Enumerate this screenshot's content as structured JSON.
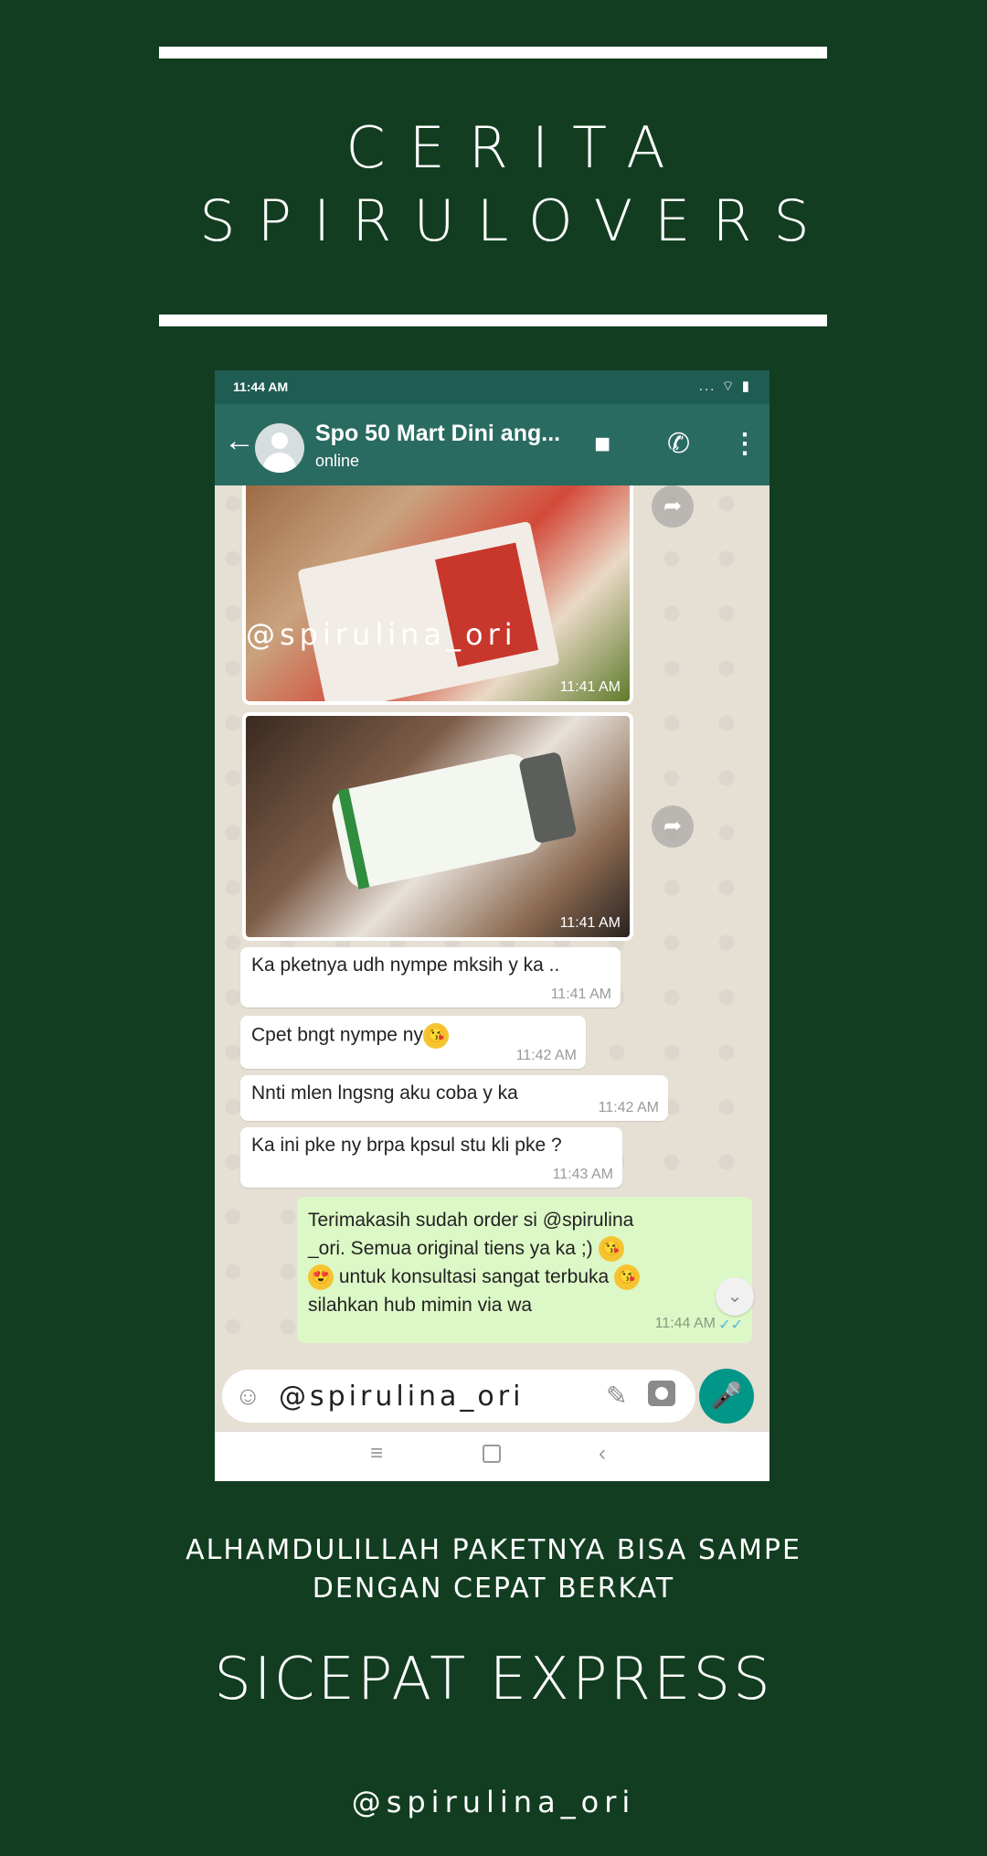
{
  "poster": {
    "title_line1": "CERITA",
    "title_line2": "SPIRULOVERS",
    "caption_line1": "ALHAMDULILLAH PAKETNYA BISA SAMPE",
    "caption_line2": "DENGAN CEPAT BERKAT",
    "headline": "SICEPAT EXPRESS",
    "handle": "@spirulina_ori",
    "colors": {
      "background": "#123d21",
      "text": "#ffffff"
    }
  },
  "status_bar": {
    "time": "11:44 AM",
    "icons": "... ⌔ ▮"
  },
  "chat_header": {
    "back_icon": "←",
    "contact_name": "Spo 50 Mart Dini ang...",
    "status": "online",
    "video_icon": "■",
    "call_icon": "✆",
    "more_icon": "⋮"
  },
  "photos": [
    {
      "watermark": "@spirulina_ori",
      "time": "11:41 AM"
    },
    {
      "time": "11:41 AM"
    }
  ],
  "forward_icon": "➦",
  "messages_in": [
    {
      "text": "Ka pketnya udh nympe mksih y ka ..",
      "time": "11:41 AM"
    },
    {
      "text": "Cpet bngt nympe ny",
      "emoji": "😘",
      "time": "11:42 AM"
    },
    {
      "text": "Nnti mlen lngsng aku coba y ka",
      "time": "11:42 AM"
    },
    {
      "text": "Ka ini pke ny brpa kpsul stu kli pke ?",
      "time": "11:43 AM"
    }
  ],
  "message_out": {
    "line1": "Terimakasih sudah order si @spirulina",
    "line2": "_ori. Semua original tiens ya ka ;)",
    "line3": "untuk konsultasi sangat terbuka",
    "line4": "silahkan hub mimin via wa",
    "emoji_kiss": "😘",
    "emoji_love": "😍",
    "time": "11:44 AM",
    "ticks": "✓✓"
  },
  "scroll_down_icon": "⌄",
  "composer": {
    "emoji_icon": "☺",
    "text": "@spirulina_ori",
    "attach_icon": "✎",
    "mic_icon": "🎤"
  },
  "nav": {
    "menu_icon": "≡",
    "back_icon": "‹"
  }
}
